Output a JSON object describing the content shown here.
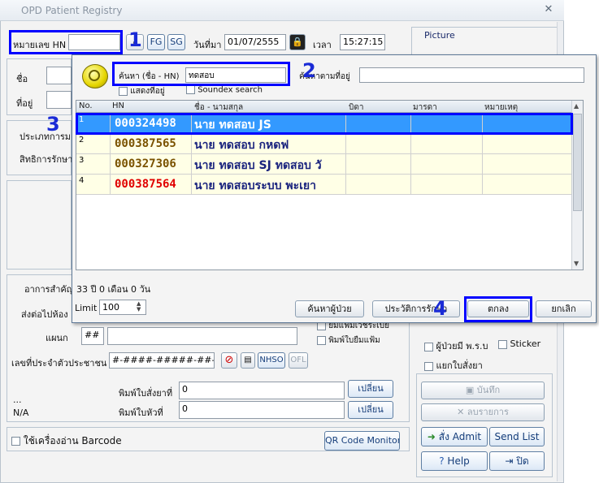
{
  "window": {
    "title": "OPD Patient Registry"
  },
  "top": {
    "hn_label": "หมายเลข HN",
    "hn_value": "",
    "fg_label": "FG",
    "sg_label": "SG",
    "date_label": "วันที่มา",
    "date_value": "01/07/2555",
    "time_label": "เวลา",
    "time_value": "15:27:15",
    "picture_label": "Picture"
  },
  "left": {
    "name_label": "ชื่อ",
    "address_label": "ที่อยู่",
    "type_label": "ประเภทการม",
    "rights_label": "สิทธิการรักษา",
    "symptom_label": "อาการสำคัญ",
    "send_label": "ส่งต่อไปห้อง",
    "dept_label": "แผนก",
    "dept_value": "##",
    "citizen_label": "เลขที่ประจำตัวประชาชน",
    "citizen_value": "#-####-#####-##-#",
    "nhso_label": "NHSO",
    "ofl_label": "OFL",
    "print_drug_label": "พิมพ์ใบสั่งยาที่",
    "print_drug_value": "0",
    "print_receipt_label": "พิมพ์ใบหัวที่",
    "print_receipt_value": "0",
    "change1_label": "เปลี่ยน",
    "change2_label": "เปลี่ยน",
    "dots": "...",
    "na": "N/A",
    "barcode_label": "ใช้เครื่องอ่าน Barcode",
    "qr_label": "QR Code Monitor",
    "opt_borrow": "ยมแฟ้มเวชระเบีย",
    "opt_print_borrow": "พิมพ์ใบยืมแฟ้ม"
  },
  "right": {
    "opt_patient": "ผู้ป่วยมี พ.ร.บ",
    "opt_sticker": "Sticker",
    "opt_split": "แยกใบสั่งยา",
    "save_label": "บันทึก",
    "delete_label": "ลบรายการ",
    "admit_label": "สั่ง Admit",
    "sendlist_label": "Send List",
    "help_label": "Help",
    "close_label": "ปิด"
  },
  "dialog": {
    "search_label": "ค้นหา (ชื่อ - HN)",
    "search_value": "ทดสอบ",
    "address_search_label": "ค้นหาตามที่อยู่",
    "address_search_value": "",
    "show_address_label": "แสดงที่อยู่",
    "soundex_label": "Soundex search",
    "columns": [
      "No.",
      "HN",
      "ชื่อ - นามสกุล",
      "บิดา",
      "มารดา",
      "หมายเหตุ"
    ],
    "rows": [
      {
        "no": "1",
        "hn": "000324498",
        "name": "นาย ทดสอบ  JS"
      },
      {
        "no": "2",
        "hn": "000387565",
        "name": "นาย ทดสอบ  กหดฟ"
      },
      {
        "no": "3",
        "hn": "000327306",
        "name": "นาย ทดสอบ SJ  ทดสอบ วั"
      },
      {
        "no": "4",
        "hn": "000387564",
        "name": "นาย ทดสอบระบบ  พะเยา"
      }
    ],
    "age_text": "33 ปี 0 เดือน 0 วัน",
    "limit_label": "Limit",
    "limit_value": "100",
    "btn_find_patient": "ค้นหาผู้ป่วย",
    "btn_history": "ประวัติการรักษา",
    "btn_ok": "ตกลง",
    "btn_cancel": "ยกเลิก"
  },
  "markers": {
    "m1": "1",
    "m2": "2",
    "m3": "3",
    "m4": "4"
  },
  "colors": {
    "selected_row": "#3399ff",
    "row_bg": "#ffffe6",
    "hn_normal": "#7a5200",
    "hn_alert": "#e00000",
    "name_color": "#1a237e",
    "marker": "#0000ff"
  }
}
